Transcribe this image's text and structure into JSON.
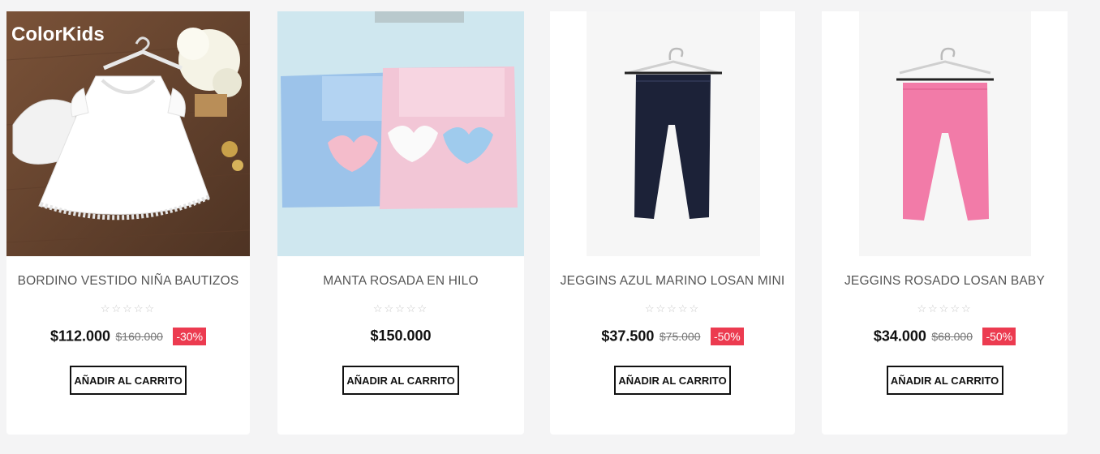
{
  "products": [
    {
      "title": "BORDINO VESTIDO NIÑA BAUTIZOS",
      "rating_stars": "☆☆☆☆☆",
      "price": "$112.000",
      "old_price": "$160.000",
      "discount": "-30%",
      "button_label": "AÑADIR AL CARRITO",
      "image_brand": "ColorKids"
    },
    {
      "title": "MANTA ROSADA EN HILO",
      "rating_stars": "☆☆☆☆☆",
      "price": "$150.000",
      "old_price": "",
      "discount": "",
      "button_label": "AÑADIR AL CARRITO"
    },
    {
      "title": "JEGGINS AZUL MARINO LOSAN MINI",
      "rating_stars": "☆☆☆☆☆",
      "price": "$37.500",
      "old_price": "$75.000",
      "discount": "-50%",
      "button_label": "AÑADIR AL CARRITO"
    },
    {
      "title": "JEGGINS ROSADO LOSAN BABY",
      "rating_stars": "☆☆☆☆☆",
      "price": "$34.000",
      "old_price": "$68.000",
      "discount": "-50%",
      "button_label": "AÑADIR AL CARRITO"
    }
  ],
  "colors": {
    "page_background": "#f4f4f5",
    "discount_badge": "#ec3b50",
    "navy_pants": "#1c2238",
    "pink_pants": "#f27ba8"
  }
}
